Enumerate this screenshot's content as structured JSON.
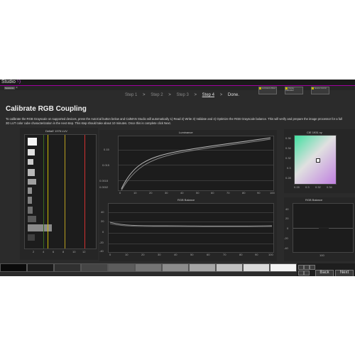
{
  "app": {
    "title": "Studio",
    "tab_label": "Sessions",
    "tab_close": "×"
  },
  "steps": [
    "Step 1",
    ">",
    "Step 2",
    ">",
    "Step 3",
    ">",
    "Step 4",
    ">",
    "Done."
  ],
  "controls": [
    "Luminance Meter",
    "Display Calibration",
    "Source Control"
  ],
  "heading": "Calibrate RGB Coupling",
  "description": "To calibrate the RGB Grayscale on supported devices, press the AutoCal button below and CalMAN Studio will automatically 1) Read 2) Write 3) Validate and 4) Optimize the RGB Grayscale balance. This will verify and prepare the image processor for a full 3D LUT color cube characterization in the next step. This step should take about 10 minutes. Once this is complete click Next.",
  "delta_chart": {
    "title": "DeltaE 1976 LUV",
    "x_ticks": [
      "2",
      "4",
      "6",
      "8",
      "10",
      "12"
    ]
  },
  "luminance_chart": {
    "title": "Luminance",
    "y_ticks": [
      "0.15",
      "0.015",
      "0.0015",
      "0.0002"
    ],
    "x_ticks": [
      "0",
      "10",
      "20",
      "30",
      "40",
      "50",
      "60",
      "70",
      "80",
      "90",
      "100"
    ]
  },
  "rgb_balance_chart": {
    "title": "RGB Balance",
    "y_ticks": [
      "40",
      "20",
      "0",
      "-20",
      "-40"
    ],
    "x_ticks": [
      "0",
      "10",
      "20",
      "30",
      "40",
      "50",
      "60",
      "70",
      "80",
      "90",
      "100"
    ]
  },
  "cie_chart": {
    "title": "CIE 1931 xy",
    "y_ticks": [
      "0.36",
      "0.34",
      "0.32",
      "0.3",
      "0.28"
    ],
    "x_ticks": [
      "0.28",
      "0.3",
      "0.32",
      "0.34"
    ]
  },
  "rgb_balance_small": {
    "title": "RGB Balance",
    "y_ticks": [
      "40",
      "20",
      "0",
      "-20",
      "-40"
    ],
    "x_label": "100"
  },
  "nav": {
    "back": "Back",
    "next": "Next"
  },
  "colors": {
    "accent": "#a000a0",
    "background": "#2b2b2b",
    "red": "#d03030",
    "green": "#40a040",
    "yellow": "#c8b800"
  }
}
